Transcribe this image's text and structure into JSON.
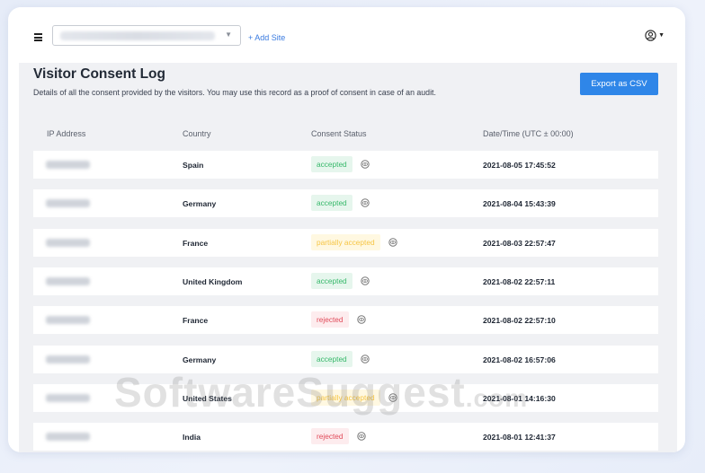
{
  "topbar": {
    "add_site_label": "+ Add Site"
  },
  "page": {
    "title": "Visitor Consent Log",
    "subtitle": "Details of all the consent provided by the visitors. You may use this record as a proof of consent in case of an audit.",
    "export_label": "Export as CSV"
  },
  "table": {
    "headers": [
      "IP Address",
      "Country",
      "Consent Status",
      "Date/Time (UTC ± 00:00)"
    ],
    "rows": [
      {
        "country": "Spain",
        "status": "accepted",
        "datetime": "2021-08-05 17:45:52"
      },
      {
        "country": "Germany",
        "status": "accepted",
        "datetime": "2021-08-04 15:43:39"
      },
      {
        "country": "France",
        "status": "partially accepted",
        "datetime": "2021-08-03 22:57:47"
      },
      {
        "country": "United Kingdom",
        "status": "accepted",
        "datetime": "2021-08-02 22:57:11"
      },
      {
        "country": "France",
        "status": "rejected",
        "datetime": "2021-08-02 22:57:10"
      },
      {
        "country": "Germany",
        "status": "accepted",
        "datetime": "2021-08-02 16:57:06"
      },
      {
        "country": "United States",
        "status": "partially accepted",
        "datetime": "2021-08-01 14:16:30"
      },
      {
        "country": "India",
        "status": "rejected",
        "datetime": "2021-08-01 12:41:37"
      }
    ]
  },
  "status_colors": {
    "accepted": "#36b86a",
    "rejected": "#e14b5a",
    "partially accepted": "#f6c544"
  },
  "watermark": {
    "main": "SoftwareSuggest",
    "suffix": ".com"
  },
  "icons": [
    "hamburger-menu-icon",
    "chevron-down-icon",
    "user-circle-icon",
    "eye-icon"
  ]
}
